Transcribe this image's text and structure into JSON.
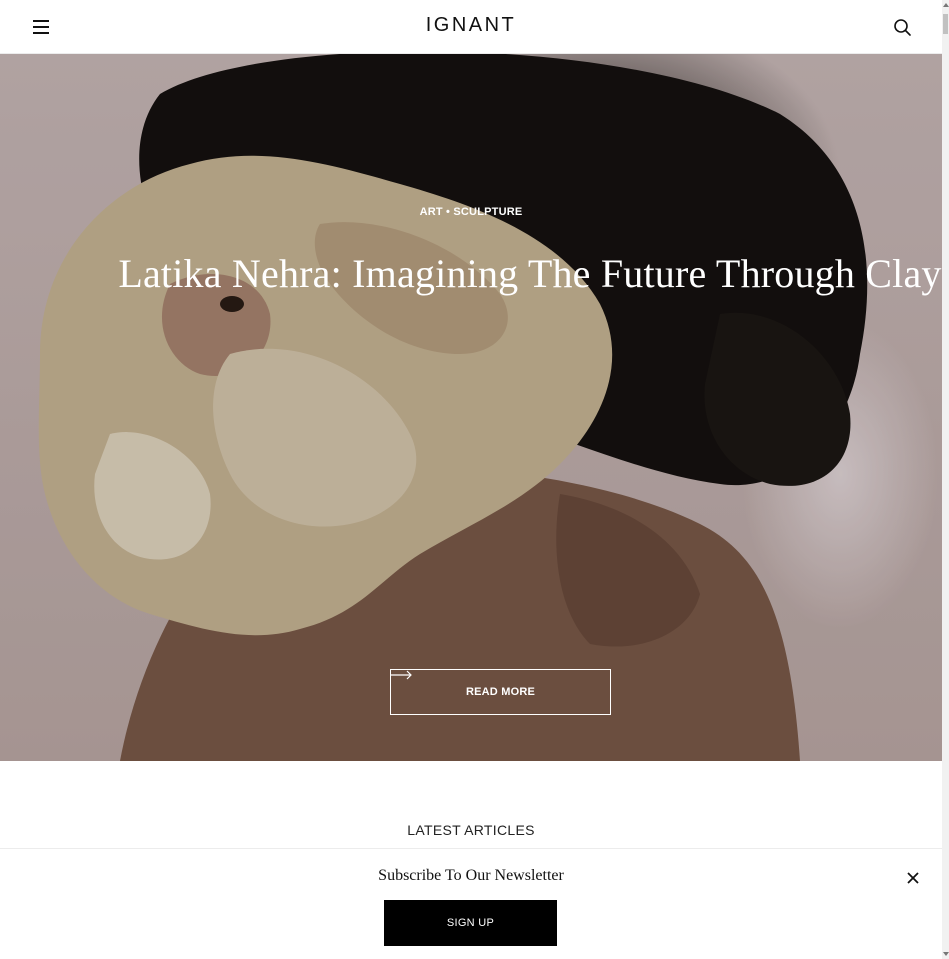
{
  "header": {
    "logo": "IGNANT",
    "menu_icon": "hamburger-icon",
    "search_icon": "search-icon"
  },
  "hero": {
    "category": "ART • SCULPTURE",
    "title": "Latika Nehra: Imagining The Future Through Clay",
    "read_more_label": "READ MORE",
    "arrow_icon": "arrow-right-icon"
  },
  "latest": {
    "heading": "LATEST ARTICLES"
  },
  "newsletter": {
    "title": "Subscribe To Our Newsletter",
    "signup_label": "SIGN UP",
    "close_icon": "close-icon"
  },
  "colors": {
    "background": "#ffffff",
    "text": "#111111",
    "button_bg": "#000000",
    "hero_text": "#ffffff"
  }
}
